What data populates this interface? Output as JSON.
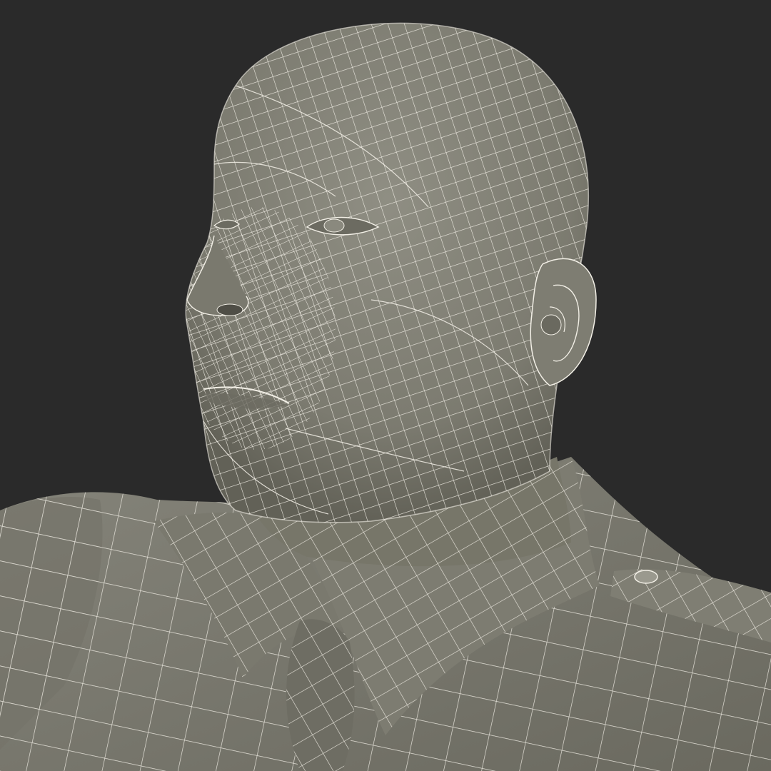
{
  "scene": {
    "subject": "wireframe-bust-uniform",
    "colors": {
      "background": "#2a2a2a",
      "surface": "#7c7b70",
      "surface_dark": "#626157",
      "surface_light": "#8f8e83",
      "wire": "#f2efe6"
    }
  }
}
